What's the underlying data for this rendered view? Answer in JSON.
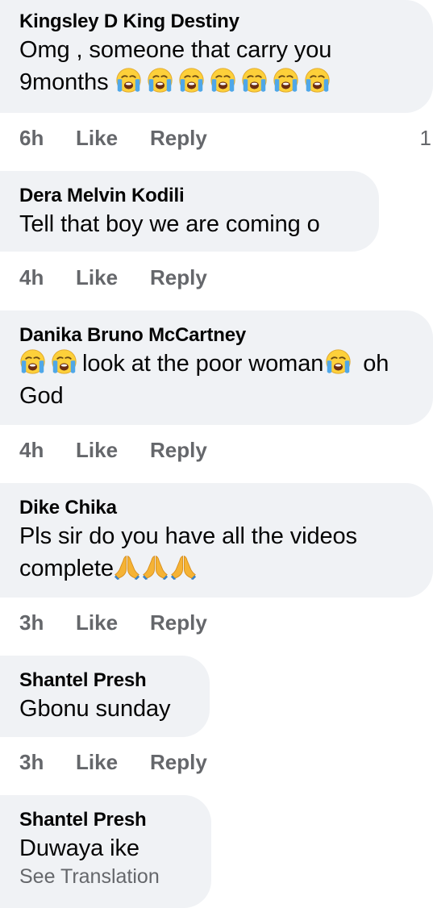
{
  "comments": [
    {
      "author": "Kingsley D King Destiny",
      "text_line1": "Omg , someone that carry you",
      "text_line2": "9months",
      "emoji_count": 7,
      "emoji_icon": "loudly-crying-face",
      "time": "6h",
      "like_label": "Like",
      "reply_label": "Reply",
      "reply_count": "1"
    },
    {
      "author": "Dera Melvin Kodili",
      "text": "Tell that boy we are coming o",
      "time": "4h",
      "like_label": "Like",
      "reply_label": "Reply"
    },
    {
      "author": "Danika Bruno McCartney",
      "text_after_emojis": "look at the poor woman",
      "text_end": "oh",
      "text_line2": "God",
      "emoji_icon": "loudly-crying-face",
      "time": "4h",
      "like_label": "Like",
      "reply_label": "Reply"
    },
    {
      "author": "Dike Chika",
      "text_line1": "Pls sir do you have all the videos",
      "text_line2": "complete",
      "emoji_icon": "folded-hands",
      "time": "3h",
      "like_label": "Like",
      "reply_label": "Reply"
    },
    {
      "author": "Shantel Presh",
      "text": "Gbonu sunday",
      "time": "3h",
      "like_label": "Like",
      "reply_label": "Reply"
    },
    {
      "author": "Shantel Presh",
      "text": "Duwaya ike",
      "see_translation": "See Translation"
    }
  ],
  "colors": {
    "bubble": "#f0f2f5",
    "text": "#050505",
    "secondary": "#65676b",
    "emoji_face": "#fdd03a",
    "emoji_tears": "#4fa7e8",
    "emoji_hands": "#f5b335"
  }
}
